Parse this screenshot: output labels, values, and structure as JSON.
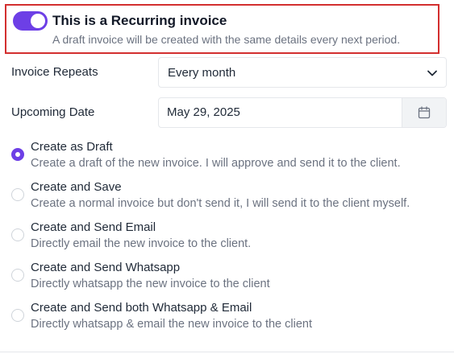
{
  "recurring": {
    "enabled": true,
    "title": "This is a Recurring invoice",
    "subtitle": "A draft invoice will be created with the same details every next period.",
    "accent_color": "#6d3fe6",
    "highlight_border_color": "#d32f2f"
  },
  "repeat": {
    "label": "Invoice Repeats",
    "value": "Every month",
    "icon": "chevron-down-icon"
  },
  "upcoming": {
    "label": "Upcoming Date",
    "value": "May 29, 2025",
    "icon": "calendar-icon"
  },
  "options": [
    {
      "title": "Create as Draft",
      "description": "Create a draft of the new invoice. I will approve and send it to the client.",
      "selected": true
    },
    {
      "title": "Create and Save",
      "description": "Create a normal invoice but don't send it, I will send it to the client myself.",
      "selected": false
    },
    {
      "title": "Create and Send Email",
      "description": "Directly email the new invoice to the client.",
      "selected": false
    },
    {
      "title": "Create and Send Whatsapp",
      "description": "Directly whatsapp the new invoice to the client",
      "selected": false
    },
    {
      "title": "Create and Send both Whatsapp & Email",
      "description": "Directly whatsapp & email the new invoice to the client",
      "selected": false
    }
  ]
}
